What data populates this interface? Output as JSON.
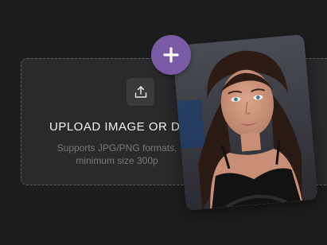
{
  "upload": {
    "title": "UPLOAD IMAGE OR DRA",
    "hint_line1": "Supports JPG/PNG formats,",
    "hint_line2": "minimum size 300p",
    "icon": "upload-icon"
  },
  "add_button": {
    "icon": "plus-icon",
    "color": "#7b5aa6"
  },
  "colors": {
    "background": "#1d1d1e",
    "dropzone": "#2a2a2c",
    "dropzone_border": "#5c5c5e",
    "text": "#f2f2f2",
    "hint_text": "#7a7a7c",
    "accent": "#7b5aa6"
  }
}
